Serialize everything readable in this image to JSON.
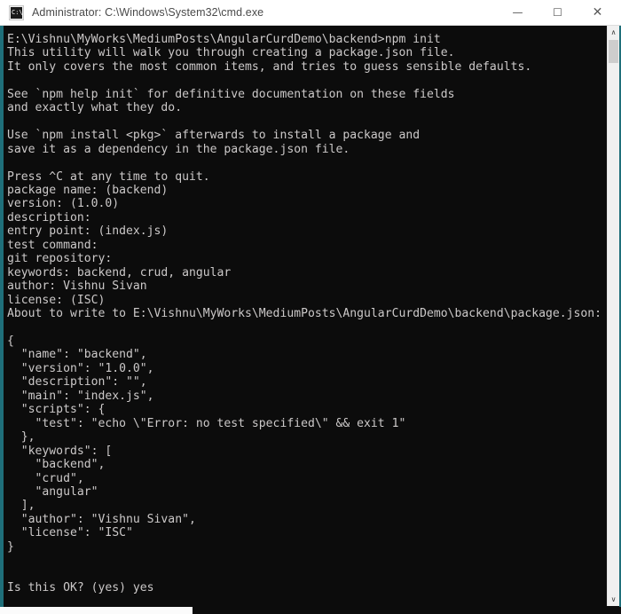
{
  "window": {
    "title": "Administrator: C:\\Windows\\System32\\cmd.exe",
    "app_icon_label": "C:\\",
    "colors": {
      "border": "#1f6f7a",
      "console_bg": "#0c0c0c",
      "console_fg": "#ccc9c9",
      "titlebar_bg": "#ffffff",
      "titlebar_fg": "#4a4a4a",
      "scrollbar_track": "#f0f0f0",
      "scrollbar_thumb": "#cdcdcd"
    },
    "controls": {
      "minimize": "—",
      "maximize": "☐",
      "close": "✕"
    }
  },
  "scrollbars": {
    "vertical": {
      "up_arrow": "∧",
      "down_arrow": "∨",
      "thumb_top_pct": 2,
      "thumb_height_pct": 4
    },
    "horizontal": {
      "thumb_left_pct": 0,
      "thumb_width_pct": 31
    }
  },
  "console": {
    "prompt_path": "E:\\Vishnu\\MyWorks\\MediumPosts\\AngularCurdDemo\\backend>",
    "command": "npm init",
    "lines": [
      "E:\\Vishnu\\MyWorks\\MediumPosts\\AngularCurdDemo\\backend>npm init",
      "This utility will walk you through creating a package.json file.",
      "It only covers the most common items, and tries to guess sensible defaults.",
      "",
      "See `npm help init` for definitive documentation on these fields",
      "and exactly what they do.",
      "",
      "Use `npm install <pkg>` afterwards to install a package and",
      "save it as a dependency in the package.json file.",
      "",
      "Press ^C at any time to quit.",
      "package name: (backend)",
      "version: (1.0.0)",
      "description:",
      "entry point: (index.js)",
      "test command:",
      "git repository:",
      "keywords: backend, crud, angular",
      "author: Vishnu Sivan",
      "license: (ISC)",
      "About to write to E:\\Vishnu\\MyWorks\\MediumPosts\\AngularCurdDemo\\backend\\package.json:",
      "",
      "{",
      "  \"name\": \"backend\",",
      "  \"version\": \"1.0.0\",",
      "  \"description\": \"\",",
      "  \"main\": \"index.js\",",
      "  \"scripts\": {",
      "    \"test\": \"echo \\\"Error: no test specified\\\" && exit 1\"",
      "  },",
      "  \"keywords\": [",
      "    \"backend\",",
      "    \"crud\",",
      "    \"angular\"",
      "  ],",
      "  \"author\": \"Vishnu Sivan\",",
      "  \"license\": \"ISC\"",
      "}",
      "",
      "",
      "Is this OK? (yes) yes",
      ""
    ],
    "prompts": [
      {
        "label": "package name:",
        "value": "(backend)"
      },
      {
        "label": "version:",
        "value": "(1.0.0)"
      },
      {
        "label": "description:",
        "value": ""
      },
      {
        "label": "entry point:",
        "value": "(index.js)"
      },
      {
        "label": "test command:",
        "value": ""
      },
      {
        "label": "git repository:",
        "value": ""
      },
      {
        "label": "keywords:",
        "value": "backend, crud, angular"
      },
      {
        "label": "author:",
        "value": "Vishnu Sivan"
      },
      {
        "label": "license:",
        "value": "(ISC)"
      }
    ],
    "package_json": {
      "name": "backend",
      "version": "1.0.0",
      "description": "",
      "main": "index.js",
      "scripts": {
        "test": "echo \\\"Error: no test specified\\\" && exit 1"
      },
      "keywords": [
        "backend",
        "crud",
        "angular"
      ],
      "author": "Vishnu Sivan",
      "license": "ISC"
    },
    "confirmation": "Is this OK? (yes) yes"
  }
}
